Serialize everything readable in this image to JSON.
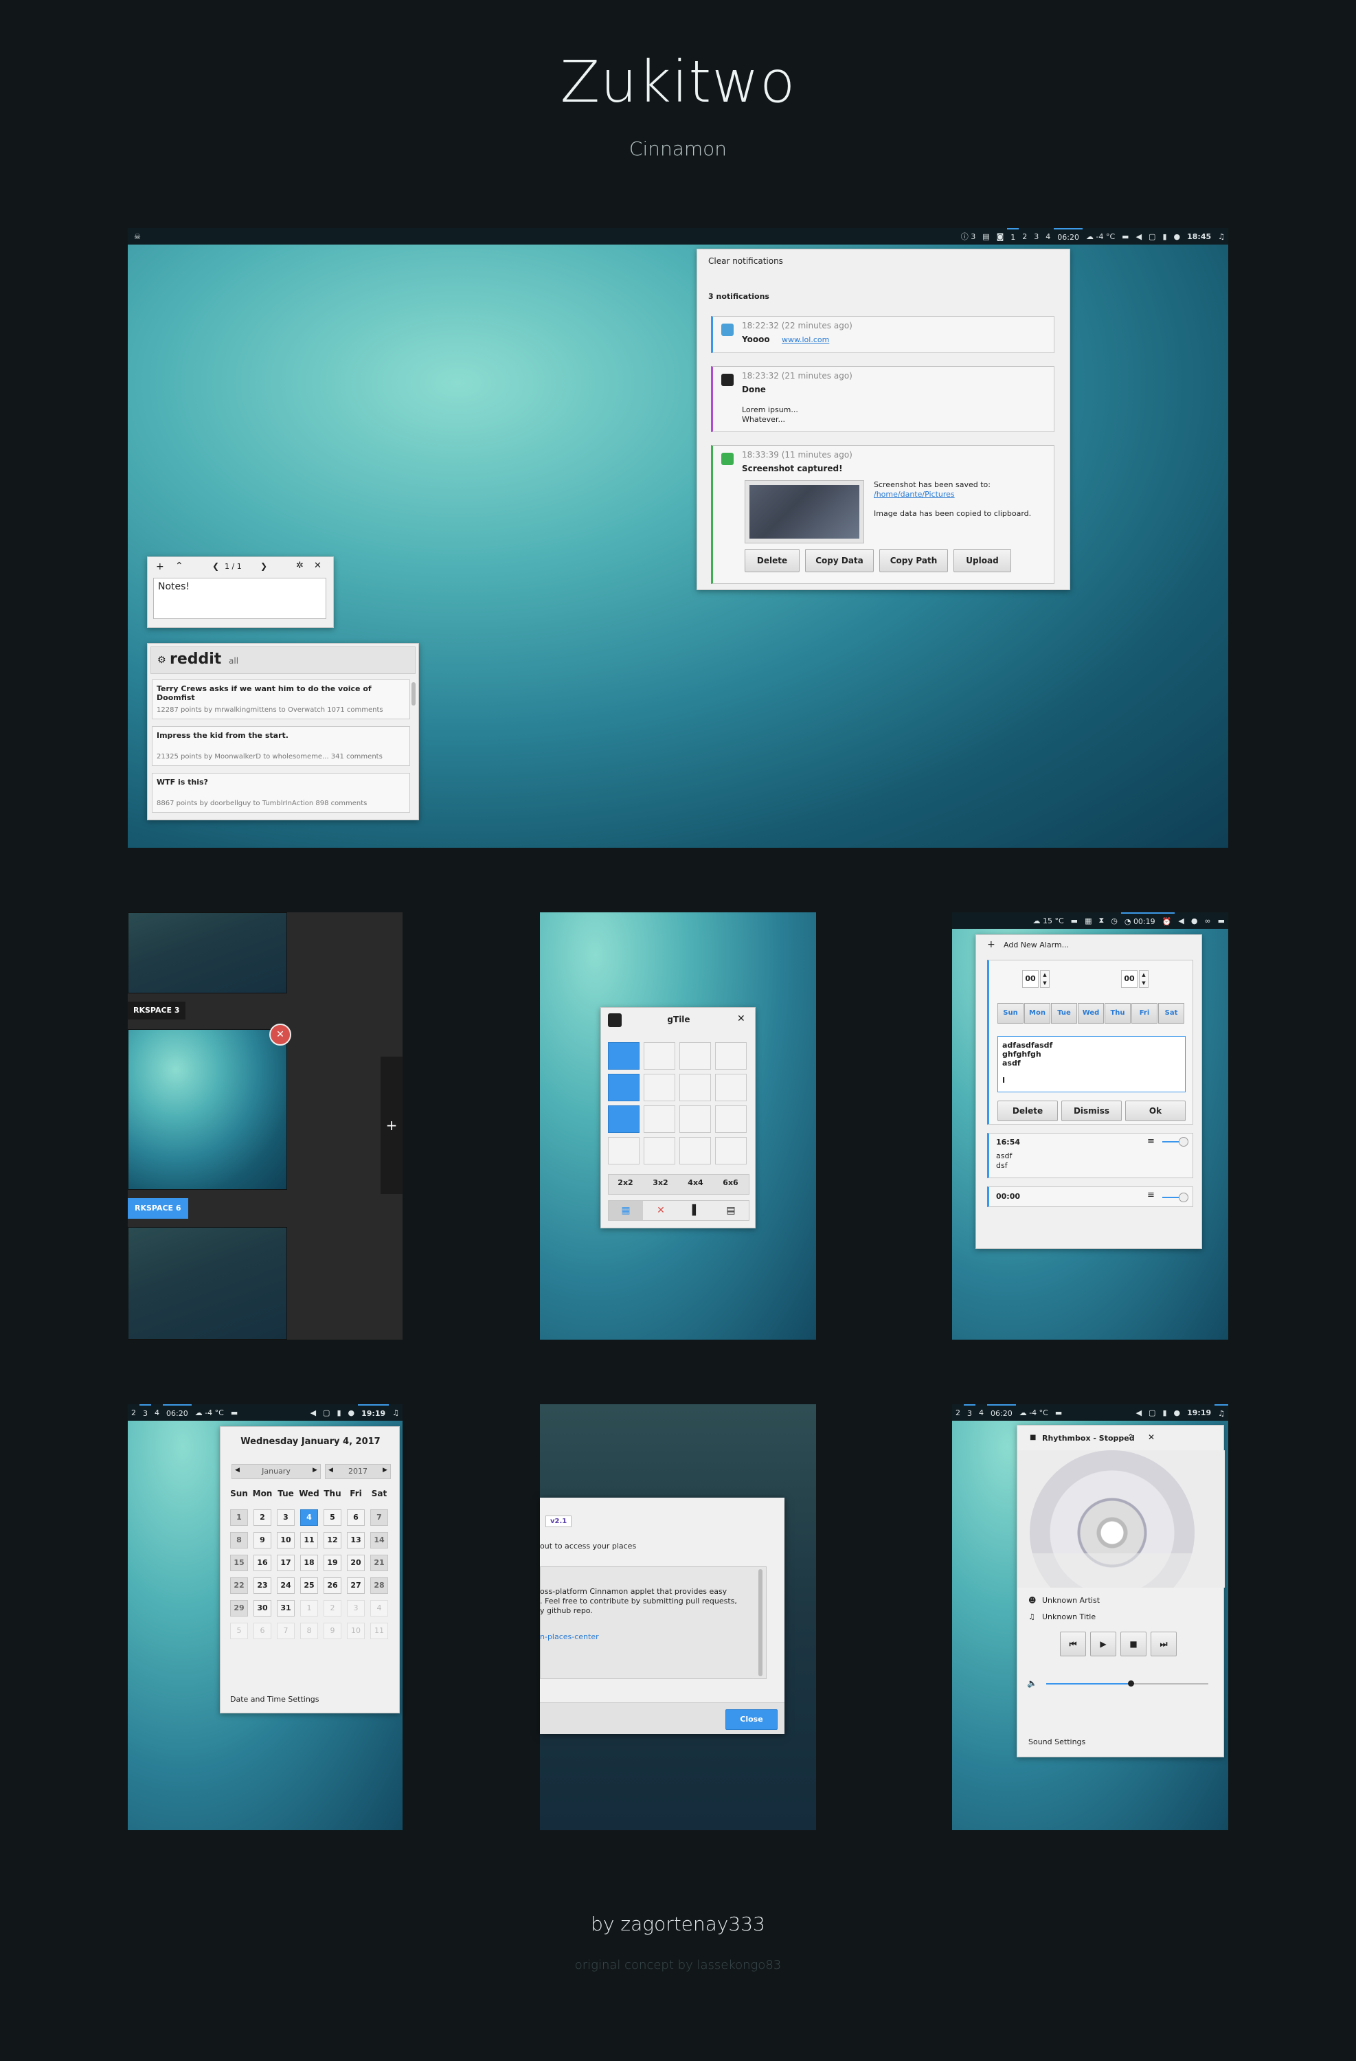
{
  "header": {
    "title": "Zukitwo",
    "subtitle": "Cinnamon"
  },
  "footer": {
    "author": "by zagortenay333",
    "credit": "original concept by lassekongo83"
  },
  "main_panel": {
    "notif_count": "3",
    "workspaces": [
      "1",
      "2",
      "3",
      "4"
    ],
    "timer": "06:20",
    "weather": "-4 °C",
    "clock": "18:45"
  },
  "notifications": {
    "clear_label": "Clear notifications",
    "count_label": "3 notifications",
    "items": [
      {
        "time": "18:22:32 (22 minutes ago)",
        "title": "Yoooo",
        "link": "www.lol.com"
      },
      {
        "time": "18:23:32 (21 minutes ago)",
        "title": "Done",
        "body1": "Lorem ipsum...",
        "body2": "Whatever..."
      },
      {
        "time": "18:33:39 (11 minutes ago)",
        "title": "Screenshot captured!",
        "body1": "Screenshot has been saved to:",
        "link": "/home/dante/Pictures",
        "body2": "Image data has been copied to clipboard.",
        "buttons": [
          "Delete",
          "Copy Data",
          "Copy Path",
          "Upload"
        ]
      }
    ]
  },
  "notes": {
    "page": "1 / 1",
    "text": "Notes!"
  },
  "reddit": {
    "logo": "reddit",
    "sub": "all",
    "posts": [
      {
        "title": "Terry Crews asks if we want him to do the voice of Doomfist",
        "meta": "12287 points by mrwalkingmittens to Overwatch 1071 comments"
      },
      {
        "title": "Impress the kid from the start.",
        "meta": "21325 points by MoonwalkerD to wholesomeme... 341 comments"
      },
      {
        "title": "WTF is this?",
        "meta": "8867 points by doorbellguy to TumblrInAction 898 comments"
      }
    ]
  },
  "expo": {
    "ws3": "RKSPACE 3",
    "ws6": "RKSPACE 6",
    "add": "+"
  },
  "gtile": {
    "title": "gTile",
    "presets": [
      "2x2",
      "3x2",
      "4x4",
      "6x6"
    ]
  },
  "alarm_panel": {
    "temp": "15 °C",
    "timer": "00:19"
  },
  "alarm": {
    "add_label": "Add New Alarm...",
    "hour": "00",
    "minute": "00",
    "days": [
      "Sun",
      "Mon",
      "Tue",
      "Wed",
      "Thu",
      "Fri",
      "Sat"
    ],
    "note_lines": [
      "adfasdfasdf",
      "ghfghfgh",
      "asdf",
      "I"
    ],
    "buttons": [
      "Delete",
      "Dismiss",
      "Ok"
    ],
    "alarm1_time": "16:54",
    "alarm1_l1": "asdf",
    "alarm1_l2": "dsf",
    "alarm2_time": "00:00"
  },
  "cal_panel": {
    "workspaces": [
      "2",
      "3",
      "4"
    ],
    "timer": "06:20",
    "weather": "-4 °C",
    "clock": "19:19"
  },
  "calendar": {
    "date": "Wednesday January 4, 2017",
    "month": "January",
    "year": "2017",
    "weekdays": [
      "Sun",
      "Mon",
      "Tue",
      "Wed",
      "Thu",
      "Fri",
      "Sat"
    ],
    "weeks": [
      [
        "1",
        "2",
        "3",
        "4",
        "5",
        "6",
        "7"
      ],
      [
        "8",
        "9",
        "10",
        "11",
        "12",
        "13",
        "14"
      ],
      [
        "15",
        "16",
        "17",
        "18",
        "19",
        "20",
        "21"
      ],
      [
        "22",
        "23",
        "24",
        "25",
        "26",
        "27",
        "28"
      ],
      [
        "29",
        "30",
        "31",
        "1",
        "2",
        "3",
        "4"
      ],
      [
        "5",
        "6",
        "7",
        "8",
        "9",
        "10",
        "11"
      ]
    ],
    "settings": "Date and Time Settings"
  },
  "places": {
    "version": "v2.1",
    "about": "out to access your places",
    "l1": "oss-platform Cinnamon applet that provides easy",
    "l2": ". Feel free to contribute by submitting pull requests,",
    "l3": "y github repo.",
    "link": "n-places-center",
    "close": "Close"
  },
  "sound_panel": {
    "workspaces": [
      "2",
      "3",
      "4"
    ],
    "timer": "06:20",
    "weather": "-4 °C",
    "clock": "19:19"
  },
  "player": {
    "title": "Rhythmbox - Stopped",
    "artist": "Unknown Artist",
    "track": "Unknown Title",
    "volume": 0.52,
    "settings": "Sound Settings"
  }
}
